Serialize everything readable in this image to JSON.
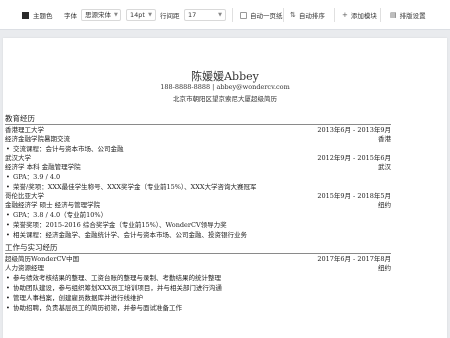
{
  "toolbar": {
    "theme_color_label": "主题色",
    "theme_color": "#2b2b2b",
    "font_label": "字体",
    "font_value": "思源宋体",
    "size_value": "14pt",
    "line_height_label": "行间距",
    "line_height_value": "17",
    "auto_page_label": "自动一页纸",
    "auto_sort_label": "自动排序",
    "add_module_label": "添加模块",
    "layout_settings_label": "排版设置"
  },
  "resume": {
    "name": "陈媛媛Abbey",
    "contact": "188-8888-8888 | abbey@wondercv.com",
    "address": "北京市朝阳区望京索尼大厦超级简历",
    "education": {
      "title": "教育经历",
      "entries": [
        {
          "left": "香港理工大学",
          "right": "2013年6月 - 2013年9月"
        },
        {
          "left": "经济金融学院暑期交流",
          "right": "香港"
        },
        {
          "bullet": "交流课程：会计与资本市场、公司金融"
        },
        {
          "left": "武汉大学",
          "right": "2012年9月 - 2015年6月"
        },
        {
          "left": "经济学 本科 金融管理学院",
          "right": "武汉"
        },
        {
          "bullet": "GPA：3.9 / 4.0"
        },
        {
          "bullet": "荣誉/奖项：XXX最佳学生称号、XXX奖学金（专业前15%）、XXX大学咨询大赛冠军"
        },
        {
          "left": "哥伦比亚大学",
          "right": "2015年9月 - 2018年5月"
        },
        {
          "left": "金融经济学 硕士 经济与管理学院",
          "right": "纽约"
        },
        {
          "bullet": "GPA：3.8 / 4.0（专业前10%）"
        },
        {
          "bullet": "荣誉奖项：2015-2016 综合奖学金（专业前15%）、WonderCV领导力奖"
        },
        {
          "bullet": "相关课程：经济金融学、金融统计学、会计与资本市场、公司金融、投资银行业务"
        }
      ]
    },
    "work": {
      "title": "工作与实习经历",
      "entries": [
        {
          "left": "超级简历WonderCV中国",
          "right": "2017年6月 - 2017年8月"
        },
        {
          "left": "人力资源经理",
          "right": "纽约"
        },
        {
          "bullet": "参与绩效考核结果的整理、工资台账的整理与录制、考勤结果的统计整理"
        },
        {
          "bullet": "协助团队建设，参与组织筹划XXX员工培训项目，并与相关部门进行沟通"
        },
        {
          "bullet": "管理人事档案，创建雇员数据库并进行线维护"
        },
        {
          "bullet": "协助招聘，负责基层员工的简历初筛，并参与面试准备工作"
        }
      ]
    }
  }
}
